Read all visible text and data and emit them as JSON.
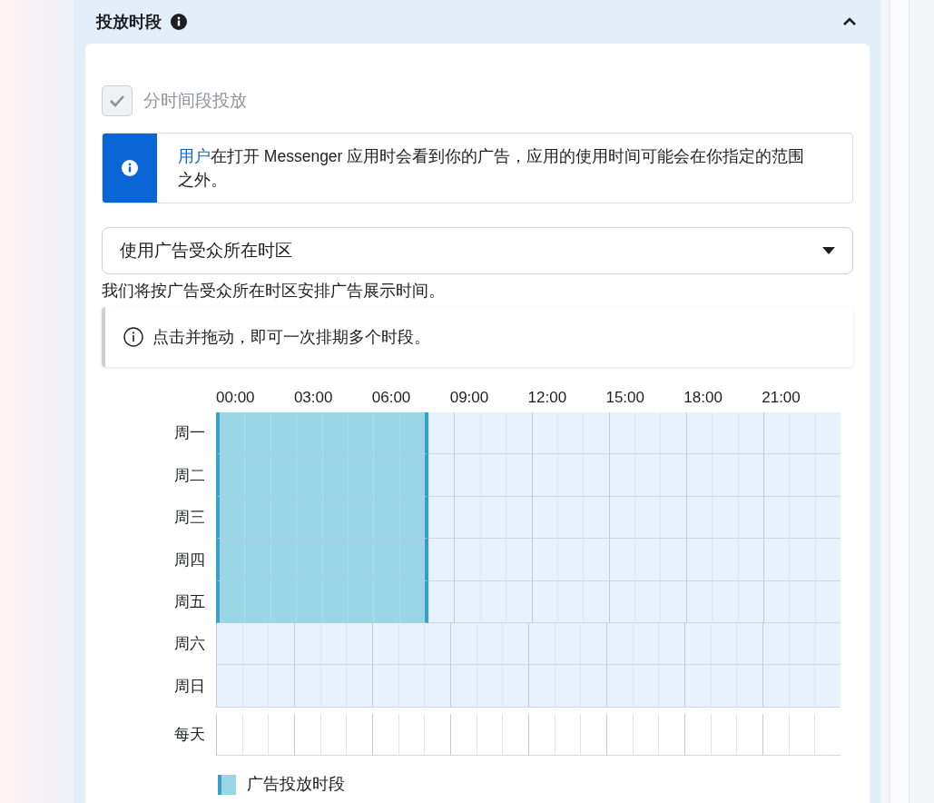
{
  "section": {
    "title": "投放时段",
    "expanded": true
  },
  "checkbox": {
    "label": "分时间段投放",
    "checked": true,
    "disabled": true
  },
  "info_banner": {
    "text": "**用户**在打开 Messenger 应用时会看到你的广告，应用的使用时间可能会在你指定的范围之外。"
  },
  "timezone_select": {
    "value": "使用广告受众所在时区"
  },
  "timezone_note": "我们将按广告受众所在时区安排广告展示时间。",
  "hint": "点击并拖动，即可一次排期多个时段。",
  "hour_labels": [
    "00:00",
    "03:00",
    "06:00",
    "09:00",
    "12:00",
    "15:00",
    "18:00",
    "21:00"
  ],
  "days": [
    {
      "label": "周一",
      "hours": [
        true,
        true,
        true,
        true,
        true,
        true,
        true,
        true,
        false,
        false,
        false,
        false,
        false,
        false,
        false,
        false,
        false,
        false,
        false,
        false,
        false,
        false,
        false,
        false
      ]
    },
    {
      "label": "周二",
      "hours": [
        true,
        true,
        true,
        true,
        true,
        true,
        true,
        true,
        false,
        false,
        false,
        false,
        false,
        false,
        false,
        false,
        false,
        false,
        false,
        false,
        false,
        false,
        false,
        false
      ]
    },
    {
      "label": "周三",
      "hours": [
        true,
        true,
        true,
        true,
        true,
        true,
        true,
        true,
        false,
        false,
        false,
        false,
        false,
        false,
        false,
        false,
        false,
        false,
        false,
        false,
        false,
        false,
        false,
        false
      ]
    },
    {
      "label": "周四",
      "hours": [
        true,
        true,
        true,
        true,
        true,
        true,
        true,
        true,
        false,
        false,
        false,
        false,
        false,
        false,
        false,
        false,
        false,
        false,
        false,
        false,
        false,
        false,
        false,
        false
      ]
    },
    {
      "label": "周五",
      "hours": [
        true,
        true,
        true,
        true,
        true,
        true,
        true,
        true,
        false,
        false,
        false,
        false,
        false,
        false,
        false,
        false,
        false,
        false,
        false,
        false,
        false,
        false,
        false,
        false
      ]
    },
    {
      "label": "周六",
      "hours": [
        false,
        false,
        false,
        false,
        false,
        false,
        false,
        false,
        false,
        false,
        false,
        false,
        false,
        false,
        false,
        false,
        false,
        false,
        false,
        false,
        false,
        false,
        false,
        false
      ]
    },
    {
      "label": "周日",
      "hours": [
        false,
        false,
        false,
        false,
        false,
        false,
        false,
        false,
        false,
        false,
        false,
        false,
        false,
        false,
        false,
        false,
        false,
        false,
        false,
        false,
        false,
        false,
        false,
        false
      ]
    }
  ],
  "everyday": {
    "label": "每天",
    "hours": [
      false,
      false,
      false,
      false,
      false,
      false,
      false,
      false,
      false,
      false,
      false,
      false,
      false,
      false,
      false,
      false,
      false,
      false,
      false,
      false,
      false,
      false,
      false,
      false
    ]
  },
  "legend": {
    "label": "广告投放时段"
  }
}
